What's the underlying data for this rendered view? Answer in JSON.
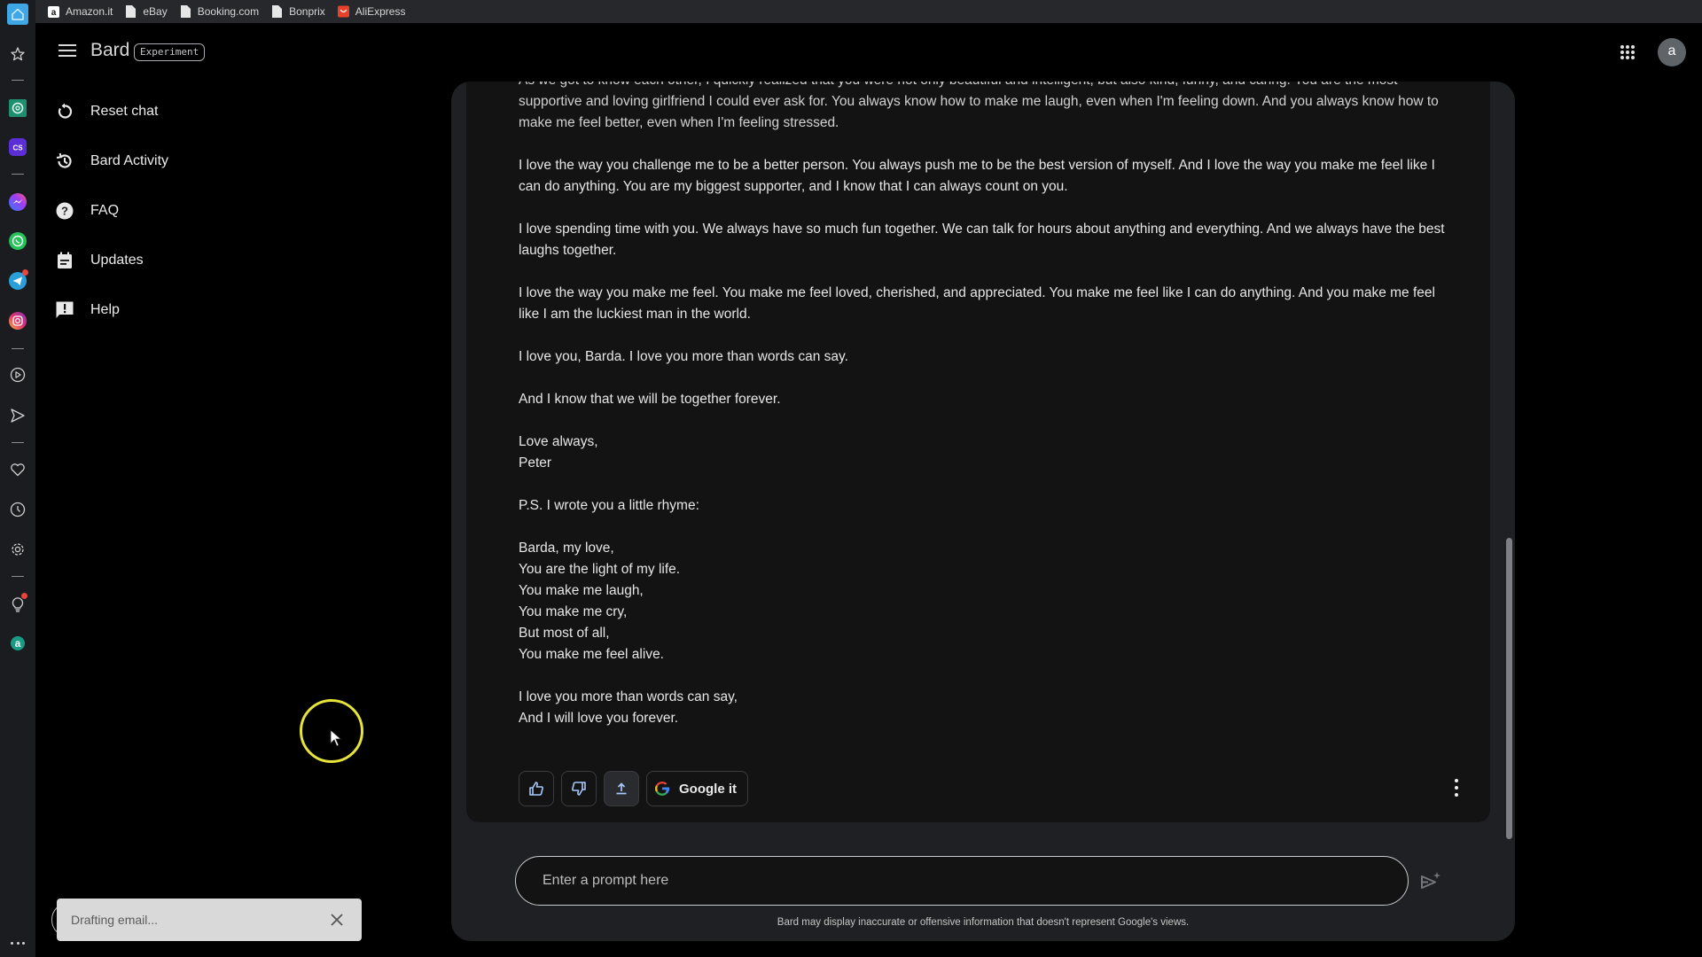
{
  "bookmarks": [
    {
      "label": "Amazon.it",
      "icon": "amazon-icon"
    },
    {
      "label": "eBay",
      "icon": "page-icon"
    },
    {
      "label": "Booking.com",
      "icon": "page-icon"
    },
    {
      "label": "Bonprix",
      "icon": "page-icon"
    },
    {
      "label": "AliExpress",
      "icon": "aliexpress-icon"
    }
  ],
  "rail": {
    "items": [
      "home-icon",
      "star-icon",
      "chatgpt-icon",
      "cs-icon",
      "messenger-icon",
      "whatsapp-icon",
      "telegram-icon",
      "instagram-icon",
      "play-icon",
      "send-icon",
      "heart-icon",
      "clock-icon",
      "gear-icon",
      "lightbulb-icon",
      "a-app-icon",
      "more-icon"
    ],
    "a_app_letter": "a",
    "cs_label": "CS"
  },
  "header": {
    "brand": "Bard",
    "badge": "Experiment",
    "avatar_letter": "a"
  },
  "sidebar": {
    "items": [
      {
        "label": "Reset chat",
        "icon": "reset-icon"
      },
      {
        "label": "Bard Activity",
        "icon": "history-icon"
      },
      {
        "label": "FAQ",
        "icon": "help-circle-icon"
      },
      {
        "label": "Updates",
        "icon": "calendar-icon"
      },
      {
        "label": "Help",
        "icon": "feedback-icon"
      }
    ]
  },
  "response": {
    "paragraphs": [
      "As we got to know each other, I quickly realized that you were not only beautiful and intelligent, but also kind, funny, and caring. You are the most supportive and loving girlfriend I could ever ask for. You always know how to make me laugh, even when I'm feeling down. And you always know how to make me feel better, even when I'm feeling stressed.",
      "I love the way you challenge me to be a better person. You always push me to be the best version of myself. And I love the way you make me feel like I can do anything. You are my biggest supporter, and I know that I can always count on you.",
      "I love spending time with you. We always have so much fun together. We can talk for hours about anything and everything. And we always have the best laughs together.",
      "I love the way you make me feel. You make me feel loved, cherished, and appreciated. You make me feel like I can do anything. And you make me feel like I am the luckiest man in the world.",
      "I love you, Barda. I love you more than words can say.",
      "And I know that we will be together forever.",
      "Love always,\nPeter",
      "P.S. I wrote you a little rhyme:",
      "Barda, my love,\nYou are the light of my life.\nYou make me laugh,\nYou make me cry,\nBut most of all,\nYou make me feel alive.",
      "I love you more than words can say,\nAnd I will love you forever."
    ]
  },
  "actions": {
    "thumbs_up": "thumbs-up-icon",
    "thumbs_down": "thumbs-down-icon",
    "share": "share-icon",
    "google_it_label": "Google it"
  },
  "input": {
    "placeholder": "Enter a prompt here",
    "value": ""
  },
  "disclaimer": "Bard may display inaccurate or offensive information that doesn't represent Google's views.",
  "toast": {
    "text": "Drafting email..."
  },
  "colors": {
    "panel": "#1f2023",
    "card": "#131314",
    "cursor_ring": "#e6e33a",
    "toast_bg": "#d9d9d9"
  }
}
